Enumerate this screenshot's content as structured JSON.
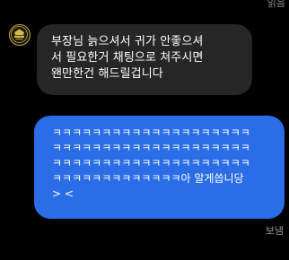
{
  "header": {
    "top_status": "읽음"
  },
  "messages": {
    "incoming": {
      "avatar_icon": "team-emblem-icon",
      "text": "부장님 늙으셔서 귀가 안좋으셔\n서 필요한거 채팅으로 쳐주시면\n왠만한건 해드릴겁니다"
    },
    "outgoing": {
      "text": "ㅋㅋㅋㅋㅋㅋㅋㅋㅋㅋㅋㅋㅋㅋㅋㅋㅋㅋㅋㅋ\nㅋㅋㅋㅋㅋㅋㅋㅋㅋㅋㅋㅋㅋㅋㅋㅋㅋㅋㅋㅋ\nㅋㅋㅋㅋㅋㅋㅋㅋㅋㅋㅋㅋㅋㅋㅋㅋㅋㅋㅋㅋ\nㅋㅋㅋㅋㅋㅋㅋㅋㅋㅋㅋㅋㅋ아 알게씁니당\n> <",
      "status": "보냄"
    }
  },
  "colors": {
    "background": "#000000",
    "incoming_bubble": "#262626",
    "outgoing_bubble": "#2a6de6",
    "status_text": "#9a9a9a"
  }
}
